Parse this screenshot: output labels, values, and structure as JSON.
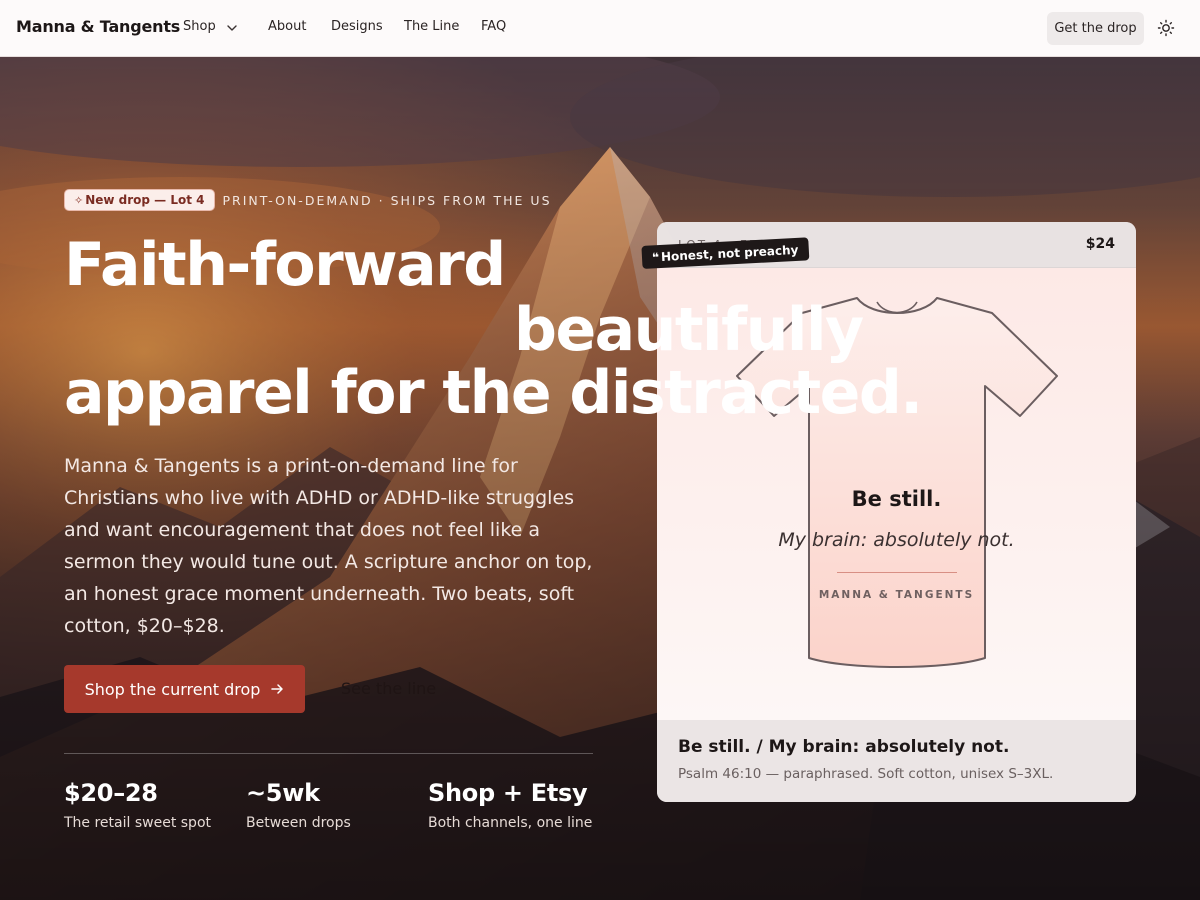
{
  "nav": {
    "brand": "Manna & Tangents",
    "links": [
      "Shop",
      "About",
      "Designs",
      "The Line",
      "FAQ"
    ],
    "cta": "Get the drop",
    "icons": {
      "shop_dropdown": "chevron-down-icon",
      "theme": "sun-icon"
    }
  },
  "hero": {
    "badge": "New drop — Lot 4",
    "badge_icon": "sparkle-icon",
    "eyebrow": "PRINT-ON-DEMAND · SHIPS FROM THE US",
    "headline": {
      "line1": "Faith-forward",
      "line2": "beautifully",
      "line3": "apparel for the distracted."
    },
    "lede": "Manna & Tangents is a print-on-demand line for Christians who live with ADHD or ADHD-like struggles and want encouragement that does not feel like a sermon they would tune out. A scripture anchor on top, an honest grace moment underneath. Two beats, soft cotton, $20–$28.",
    "primary_cta": "Shop the current drop",
    "secondary_cta": "See the line",
    "stats": [
      {
        "value": "$20–28",
        "label": "The retail sweet spot"
      },
      {
        "value": "~5wk",
        "label": "Between drops"
      },
      {
        "value": "Shop + Etsy",
        "label": "Both channels, one line"
      }
    ]
  },
  "feature_card": {
    "kicker": "LOT 4 · FEATURE",
    "price": "$24",
    "sticker": "Honest, not preachy",
    "sticker_icon": "quote-icon",
    "shirt": {
      "line1": "Be still.",
      "line2": "My brain: absolutely not.",
      "brand_mark": "MANNA & TANGENTS"
    },
    "title": "Be still. / My brain: absolutely not.",
    "subtitle": "Psalm 46:10 — paraphrased. Soft cotton, unisex S–3XL."
  },
  "colors": {
    "accent": "#a6392c",
    "badge_bg": "#fbeeea",
    "nav_bg": "#fdfafa"
  }
}
